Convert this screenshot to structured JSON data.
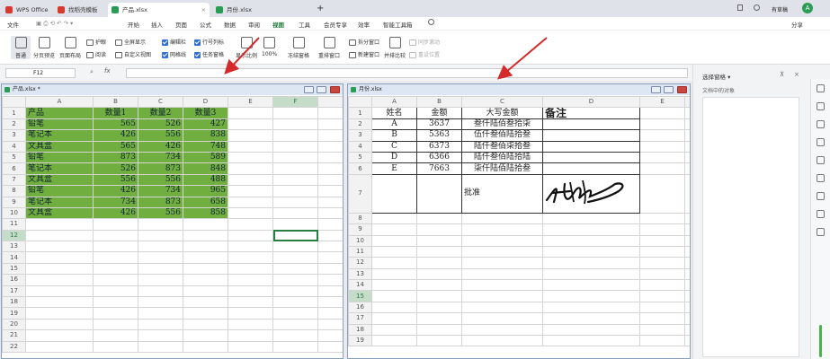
{
  "tabs": [
    {
      "label": "WPS Office",
      "color": "#d63b2f"
    },
    {
      "label": "找稻壳模板",
      "color": "#d63b2f"
    },
    {
      "label": "产品.xlsx",
      "color": "#2a9d55"
    },
    {
      "label": "月份.xlsx",
      "color": "#2a9d55"
    }
  ],
  "tabbar": {
    "add_label": "+",
    "right_label": "有草稿",
    "avatar_label": "A"
  },
  "menu": {
    "file": "文件",
    "items": [
      "开始",
      "插入",
      "页面",
      "公式",
      "数据",
      "审阅",
      "视图",
      "工具",
      "会员专享",
      "效率",
      "智能工具箱"
    ],
    "active_index": 5,
    "share": "分享"
  },
  "ribbon": {
    "big": [
      "普通",
      "分页预览",
      "页面布局"
    ],
    "small1": [
      "护眼",
      "阅读"
    ],
    "small2": [
      "全屏显示",
      "自定义视图"
    ],
    "checks": [
      "编辑栏",
      "网格线",
      "行号列标",
      "任务窗格"
    ],
    "zoom": [
      "显示比例",
      "100%"
    ],
    "freeze": [
      "冻结窗格",
      "重排窗口"
    ],
    "split": [
      "拆分窗口",
      "新建窗口",
      "并排比较"
    ],
    "disabled": [
      "同步滚动",
      "重设位置"
    ]
  },
  "formula": {
    "cell": "F12",
    "fx": "fx"
  },
  "panel": {
    "title": "选择窗格",
    "subtitle": "文档中的对象"
  },
  "w1": {
    "title": "产品.xlsx *",
    "cols": [
      "A",
      "B",
      "C",
      "D",
      "E",
      "F"
    ],
    "rows": [
      [
        "产品",
        "数量1",
        "数量2",
        "数量3"
      ],
      [
        "铅笔",
        "565",
        "526",
        "427"
      ],
      [
        "笔记本",
        "426",
        "556",
        "838"
      ],
      [
        "文具盒",
        "565",
        "426",
        "748"
      ],
      [
        "铅笔",
        "873",
        "734",
        "589"
      ],
      [
        "笔记本",
        "526",
        "873",
        "848"
      ],
      [
        "文具盒",
        "556",
        "556",
        "488"
      ],
      [
        "铅笔",
        "426",
        "734",
        "965"
      ],
      [
        "笔记本",
        "734",
        "873",
        "658"
      ],
      [
        "文具盒",
        "426",
        "556",
        "858"
      ]
    ],
    "extra_rows": [
      "11",
      "12",
      "13",
      "14",
      "15",
      "16",
      "17",
      "18",
      "19",
      "20",
      "21",
      "22"
    ]
  },
  "w2": {
    "title": "月份.xlsx",
    "cols": [
      "A",
      "B",
      "C",
      "D",
      "E"
    ],
    "header": [
      "姓名",
      "金额",
      "大写金额",
      "备注"
    ],
    "rows": [
      [
        "A",
        "3637",
        "叁仟陆佰叁拾柒"
      ],
      [
        "B",
        "5363",
        "伍仟叁佰陆拾叁"
      ],
      [
        "C",
        "6373",
        "陆仟叁佰柒拾叁"
      ],
      [
        "D",
        "6366",
        "陆仟叁佰陆拾陆"
      ],
      [
        "E",
        "7663",
        "柒仟陆佰陆拾叁"
      ]
    ],
    "approve": "批准",
    "extra_rows": [
      "8",
      "9",
      "10",
      "11",
      "12",
      "13",
      "14",
      "15",
      "16",
      "17",
      "18",
      "19"
    ]
  },
  "accent": "#2a7d40",
  "arrow": "#d42a2a"
}
